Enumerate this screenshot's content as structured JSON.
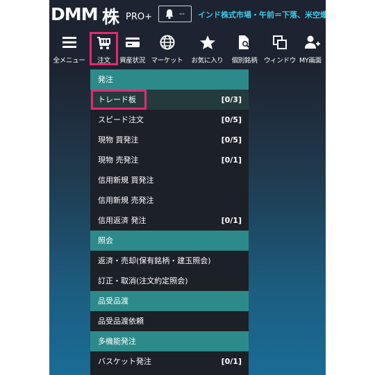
{
  "header": {
    "logo_dmm": "DMM",
    "logo_kabu": "株",
    "logo_pro": "PRO+",
    "bell_count": "--",
    "ticker": "インド株式市場・午前＝下落、米空爆"
  },
  "toolbar": [
    {
      "label": "全メニュー",
      "icon": "hamburger-icon"
    },
    {
      "label": "注文",
      "icon": "cart-icon",
      "active": true
    },
    {
      "label": "資産状況",
      "icon": "card-icon"
    },
    {
      "label": "マーケット",
      "icon": "globe-icon"
    },
    {
      "label": "お気に入り",
      "icon": "star-icon"
    },
    {
      "label": "個別銘柄",
      "icon": "document-search-icon"
    },
    {
      "label": "ウィンドウ",
      "icon": "windows-icon"
    },
    {
      "label": "MY画面",
      "icon": "user-add-icon"
    }
  ],
  "menu": {
    "sections": [
      {
        "title": "発注",
        "items": [
          {
            "label": "トレード板",
            "count": "[0/3]",
            "selected": true
          },
          {
            "label": "スピード注文",
            "count": "[0/5]"
          },
          {
            "label": "現物 買発注",
            "count": "[0/5]"
          },
          {
            "label": "現物 売発注",
            "count": "[0/1]"
          },
          {
            "label": "信用新規 買発注",
            "count": ""
          },
          {
            "label": "信用新規 売発注",
            "count": ""
          },
          {
            "label": "信用返済 発注",
            "count": "[0/1]"
          }
        ]
      },
      {
        "title": "照会",
        "items": [
          {
            "label": "返済・売却(保有銘柄・建玉照会)",
            "count": ""
          },
          {
            "label": "訂正・取消(注文約定照会)",
            "count": ""
          }
        ]
      },
      {
        "title": "品受品渡",
        "items": [
          {
            "label": "品受品渡依頼",
            "count": ""
          }
        ]
      },
      {
        "title": "多機能発注",
        "items": [
          {
            "label": "バスケット発注",
            "count": "[0/1]"
          }
        ]
      }
    ]
  },
  "colors": {
    "accent_highlight": "#e8286f",
    "section_header": "#2d8a8a",
    "ticker": "#3fc7ea",
    "background_top": "#1d2330",
    "background_bottom": "#1a6c96"
  }
}
